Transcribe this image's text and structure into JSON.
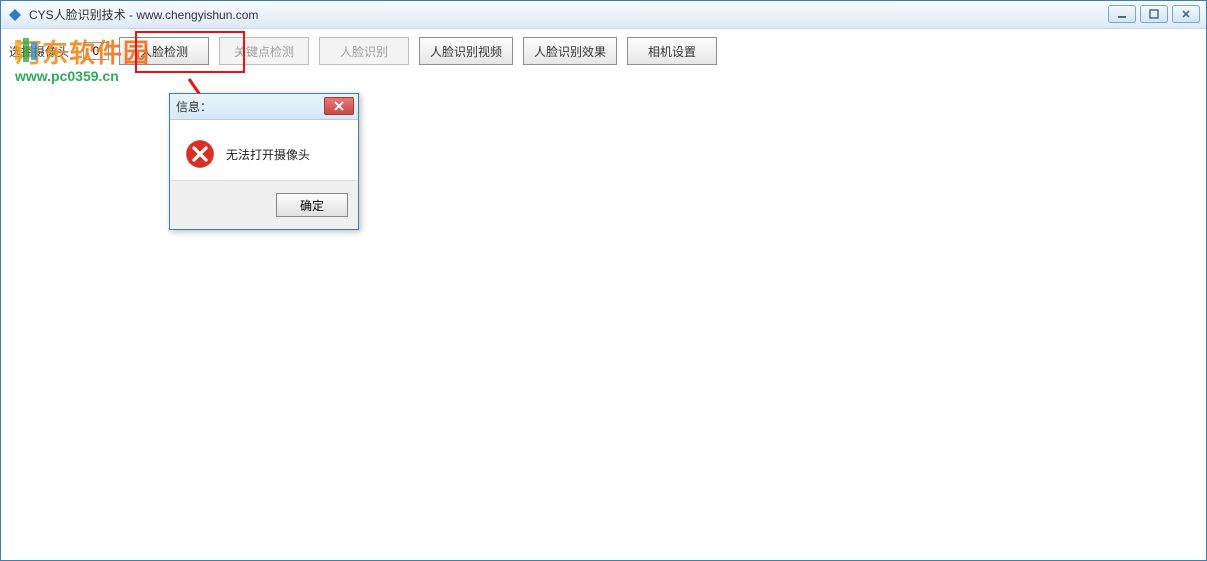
{
  "window": {
    "title": "CYS人脸识别技术 - www.chengyishun.com"
  },
  "toolbar": {
    "camera_label": "选择摄像头",
    "camera_value": "0",
    "buttons": {
      "face_detect": "人脸检测",
      "keypoint_detect": "关键点检测",
      "face_recog": "人脸识别",
      "video": "人脸识别视频",
      "effect": "人脸识别效果",
      "camera_settings": "相机设置"
    }
  },
  "dialog": {
    "title": "信息：",
    "message": "无法打开摄像头",
    "ok": "确定"
  },
  "watermark": {
    "main": "河东软件园",
    "sub": "www.pc0359.cn"
  }
}
